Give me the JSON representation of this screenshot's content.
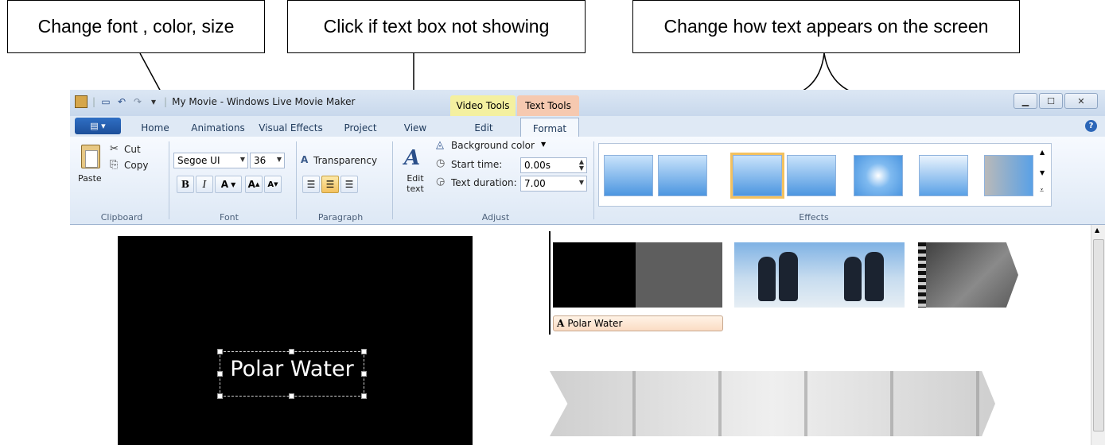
{
  "callouts": {
    "font": "Change font , color, size",
    "textbox": "Click if text box not showing",
    "effects": "Change how text appears on the screen"
  },
  "window": {
    "title": "My Movie - Windows Live Movie Maker",
    "context_tabs": [
      "Video Tools",
      "Text Tools"
    ],
    "tabs": [
      "Home",
      "Animations",
      "Visual Effects",
      "Project",
      "View",
      "Edit",
      "Format"
    ],
    "active_tab": "Format",
    "help_glyph": "?"
  },
  "ribbon": {
    "clipboard": {
      "paste": "Paste",
      "cut": "Cut",
      "copy": "Copy",
      "label": "Clipboard"
    },
    "font": {
      "family": "Segoe UI",
      "size": "36",
      "bold": "B",
      "italic": "I",
      "color": "A",
      "grow": "A",
      "shrink": "A",
      "label": "Font"
    },
    "paragraph": {
      "transparency": "Transparency",
      "label": "Paragraph"
    },
    "adjust": {
      "edit_text": "Edit text",
      "background_color": "Background color",
      "start_time_label": "Start time:",
      "start_time_value": "0.00s",
      "text_duration_label": "Text duration:",
      "text_duration_value": "7.00",
      "label": "Adjust"
    },
    "effects": {
      "label": "Effects",
      "selected_index": 2
    }
  },
  "preview": {
    "caption": "Polar Water"
  },
  "timeline": {
    "text_clip_label": "Polar Water",
    "text_clip_icon": "A"
  },
  "colors": {
    "accent": "#f3c15f",
    "context_video": "#f4f0a0",
    "context_text": "#f6c9b0"
  }
}
